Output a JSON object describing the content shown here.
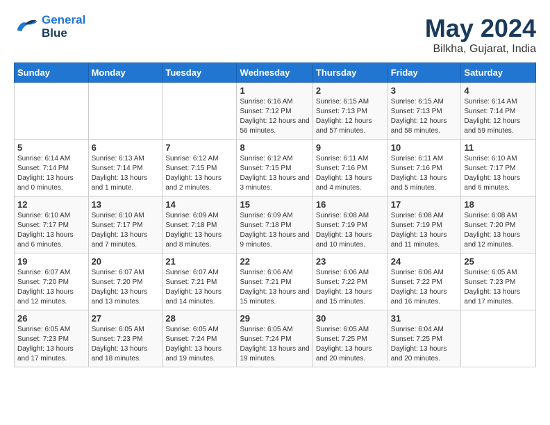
{
  "header": {
    "logo_general": "General",
    "logo_blue": "Blue",
    "month": "May 2024",
    "location": "Bilkha, Gujarat, India"
  },
  "weekdays": [
    "Sunday",
    "Monday",
    "Tuesday",
    "Wednesday",
    "Thursday",
    "Friday",
    "Saturday"
  ],
  "weeks": [
    [
      {
        "day": "",
        "sunrise": "",
        "sunset": "",
        "daylight": ""
      },
      {
        "day": "",
        "sunrise": "",
        "sunset": "",
        "daylight": ""
      },
      {
        "day": "",
        "sunrise": "",
        "sunset": "",
        "daylight": ""
      },
      {
        "day": "1",
        "sunrise": "Sunrise: 6:16 AM",
        "sunset": "Sunset: 7:12 PM",
        "daylight": "Daylight: 12 hours and 56 minutes."
      },
      {
        "day": "2",
        "sunrise": "Sunrise: 6:15 AM",
        "sunset": "Sunset: 7:13 PM",
        "daylight": "Daylight: 12 hours and 57 minutes."
      },
      {
        "day": "3",
        "sunrise": "Sunrise: 6:15 AM",
        "sunset": "Sunset: 7:13 PM",
        "daylight": "Daylight: 12 hours and 58 minutes."
      },
      {
        "day": "4",
        "sunrise": "Sunrise: 6:14 AM",
        "sunset": "Sunset: 7:14 PM",
        "daylight": "Daylight: 12 hours and 59 minutes."
      }
    ],
    [
      {
        "day": "5",
        "sunrise": "Sunrise: 6:14 AM",
        "sunset": "Sunset: 7:14 PM",
        "daylight": "Daylight: 13 hours and 0 minutes."
      },
      {
        "day": "6",
        "sunrise": "Sunrise: 6:13 AM",
        "sunset": "Sunset: 7:14 PM",
        "daylight": "Daylight: 13 hours and 1 minute."
      },
      {
        "day": "7",
        "sunrise": "Sunrise: 6:12 AM",
        "sunset": "Sunset: 7:15 PM",
        "daylight": "Daylight: 13 hours and 2 minutes."
      },
      {
        "day": "8",
        "sunrise": "Sunrise: 6:12 AM",
        "sunset": "Sunset: 7:15 PM",
        "daylight": "Daylight: 13 hours and 3 minutes."
      },
      {
        "day": "9",
        "sunrise": "Sunrise: 6:11 AM",
        "sunset": "Sunset: 7:16 PM",
        "daylight": "Daylight: 13 hours and 4 minutes."
      },
      {
        "day": "10",
        "sunrise": "Sunrise: 6:11 AM",
        "sunset": "Sunset: 7:16 PM",
        "daylight": "Daylight: 13 hours and 5 minutes."
      },
      {
        "day": "11",
        "sunrise": "Sunrise: 6:10 AM",
        "sunset": "Sunset: 7:17 PM",
        "daylight": "Daylight: 13 hours and 6 minutes."
      }
    ],
    [
      {
        "day": "12",
        "sunrise": "Sunrise: 6:10 AM",
        "sunset": "Sunset: 7:17 PM",
        "daylight": "Daylight: 13 hours and 6 minutes."
      },
      {
        "day": "13",
        "sunrise": "Sunrise: 6:10 AM",
        "sunset": "Sunset: 7:17 PM",
        "daylight": "Daylight: 13 hours and 7 minutes."
      },
      {
        "day": "14",
        "sunrise": "Sunrise: 6:09 AM",
        "sunset": "Sunset: 7:18 PM",
        "daylight": "Daylight: 13 hours and 8 minutes."
      },
      {
        "day": "15",
        "sunrise": "Sunrise: 6:09 AM",
        "sunset": "Sunset: 7:18 PM",
        "daylight": "Daylight: 13 hours and 9 minutes."
      },
      {
        "day": "16",
        "sunrise": "Sunrise: 6:08 AM",
        "sunset": "Sunset: 7:19 PM",
        "daylight": "Daylight: 13 hours and 10 minutes."
      },
      {
        "day": "17",
        "sunrise": "Sunrise: 6:08 AM",
        "sunset": "Sunset: 7:19 PM",
        "daylight": "Daylight: 13 hours and 11 minutes."
      },
      {
        "day": "18",
        "sunrise": "Sunrise: 6:08 AM",
        "sunset": "Sunset: 7:20 PM",
        "daylight": "Daylight: 13 hours and 12 minutes."
      }
    ],
    [
      {
        "day": "19",
        "sunrise": "Sunrise: 6:07 AM",
        "sunset": "Sunset: 7:20 PM",
        "daylight": "Daylight: 13 hours and 12 minutes."
      },
      {
        "day": "20",
        "sunrise": "Sunrise: 6:07 AM",
        "sunset": "Sunset: 7:20 PM",
        "daylight": "Daylight: 13 hours and 13 minutes."
      },
      {
        "day": "21",
        "sunrise": "Sunrise: 6:07 AM",
        "sunset": "Sunset: 7:21 PM",
        "daylight": "Daylight: 13 hours and 14 minutes."
      },
      {
        "day": "22",
        "sunrise": "Sunrise: 6:06 AM",
        "sunset": "Sunset: 7:21 PM",
        "daylight": "Daylight: 13 hours and 15 minutes."
      },
      {
        "day": "23",
        "sunrise": "Sunrise: 6:06 AM",
        "sunset": "Sunset: 7:22 PM",
        "daylight": "Daylight: 13 hours and 15 minutes."
      },
      {
        "day": "24",
        "sunrise": "Sunrise: 6:06 AM",
        "sunset": "Sunset: 7:22 PM",
        "daylight": "Daylight: 13 hours and 16 minutes."
      },
      {
        "day": "25",
        "sunrise": "Sunrise: 6:05 AM",
        "sunset": "Sunset: 7:23 PM",
        "daylight": "Daylight: 13 hours and 17 minutes."
      }
    ],
    [
      {
        "day": "26",
        "sunrise": "Sunrise: 6:05 AM",
        "sunset": "Sunset: 7:23 PM",
        "daylight": "Daylight: 13 hours and 17 minutes."
      },
      {
        "day": "27",
        "sunrise": "Sunrise: 6:05 AM",
        "sunset": "Sunset: 7:23 PM",
        "daylight": "Daylight: 13 hours and 18 minutes."
      },
      {
        "day": "28",
        "sunrise": "Sunrise: 6:05 AM",
        "sunset": "Sunset: 7:24 PM",
        "daylight": "Daylight: 13 hours and 19 minutes."
      },
      {
        "day": "29",
        "sunrise": "Sunrise: 6:05 AM",
        "sunset": "Sunset: 7:24 PM",
        "daylight": "Daylight: 13 hours and 19 minutes."
      },
      {
        "day": "30",
        "sunrise": "Sunrise: 6:05 AM",
        "sunset": "Sunset: 7:25 PM",
        "daylight": "Daylight: 13 hours and 20 minutes."
      },
      {
        "day": "31",
        "sunrise": "Sunrise: 6:04 AM",
        "sunset": "Sunset: 7:25 PM",
        "daylight": "Daylight: 13 hours and 20 minutes."
      },
      {
        "day": "",
        "sunrise": "",
        "sunset": "",
        "daylight": ""
      }
    ]
  ]
}
